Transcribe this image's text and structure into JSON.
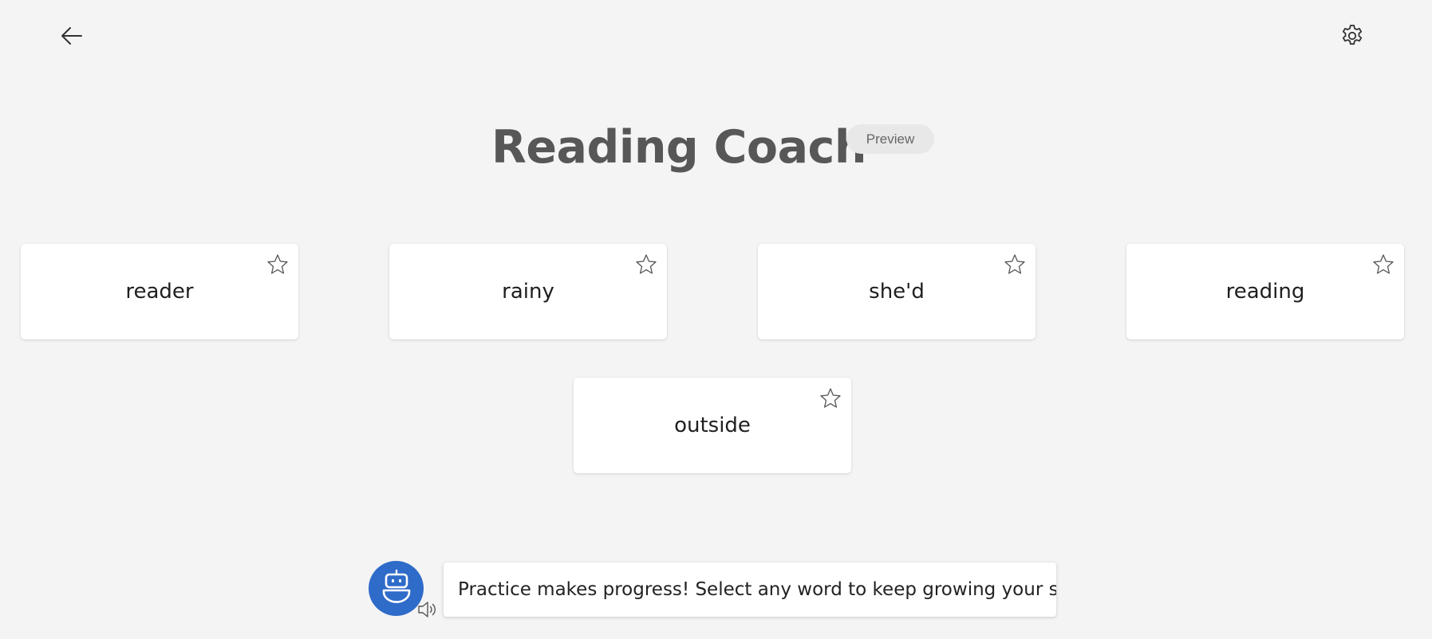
{
  "header": {
    "back_icon": "arrow-left-icon",
    "settings_icon": "gear-icon"
  },
  "title": "Reading Coach",
  "badge": "Preview",
  "words": [
    {
      "text": "reader",
      "starred": false
    },
    {
      "text": "rainy",
      "starred": false
    },
    {
      "text": "she'd",
      "starred": false
    },
    {
      "text": "reading",
      "starred": false
    },
    {
      "text": "outside",
      "starred": false
    }
  ],
  "coach": {
    "avatar_icon": "robot-icon",
    "speaker_icon": "speaker-icon",
    "message": "Practice makes progress! Select any word to keep growing your skills."
  },
  "colors": {
    "background": "#f4f4f4",
    "accent": "#2f6bc9",
    "title": "#575757"
  }
}
